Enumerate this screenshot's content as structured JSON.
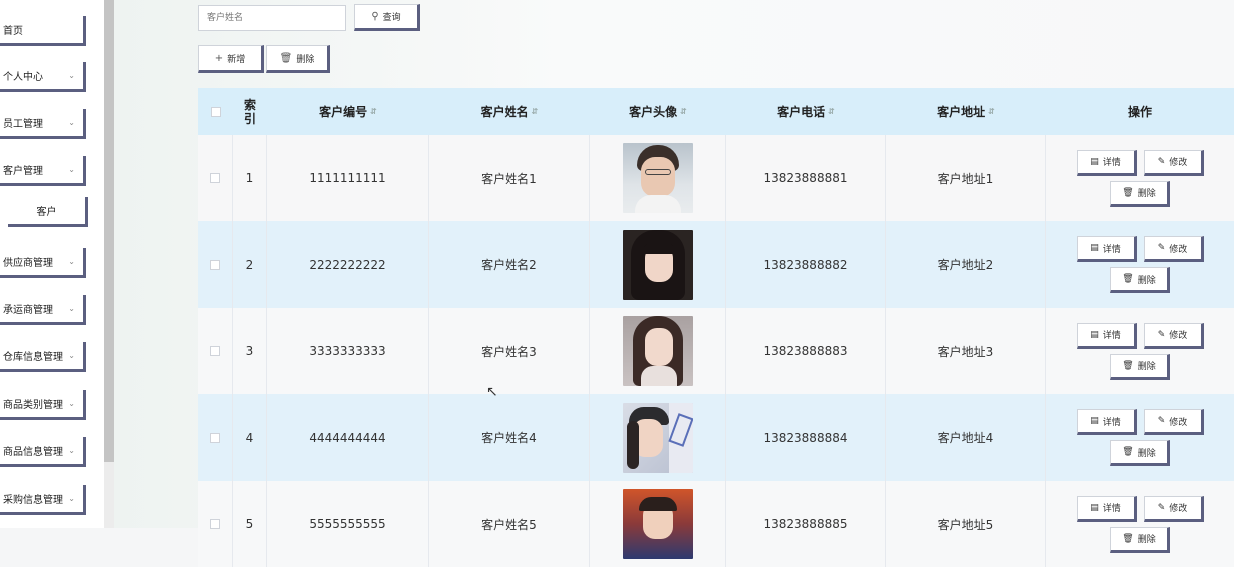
{
  "sidebar": {
    "items": [
      {
        "label": "首页",
        "chevron": false
      },
      {
        "label": "个人中心",
        "chevron": true
      },
      {
        "label": "员工管理",
        "chevron": true
      },
      {
        "label": "客户管理",
        "chevron": true
      },
      {
        "label": "客户",
        "chevron": false,
        "sub": true
      },
      {
        "label": "供应商管理",
        "chevron": true
      },
      {
        "label": "承运商管理",
        "chevron": true
      },
      {
        "label": "仓库信息管理",
        "chevron": true
      },
      {
        "label": "商品类别管理",
        "chevron": true
      },
      {
        "label": "商品信息管理",
        "chevron": true
      },
      {
        "label": "采购信息管理",
        "chevron": true
      }
    ]
  },
  "search": {
    "placeholder": "客户姓名",
    "query_label": "查询"
  },
  "toolbar": {
    "add_label": "新增",
    "delete_label": "删除"
  },
  "table": {
    "columns": [
      "索引",
      "客户编号",
      "客户姓名",
      "客户头像",
      "客户电话",
      "客户地址",
      "操作"
    ],
    "rows": [
      {
        "index": "1",
        "code": "1111111111",
        "name": "客户姓名1",
        "phone": "13823888881",
        "address": "客户地址1"
      },
      {
        "index": "2",
        "code": "2222222222",
        "name": "客户姓名2",
        "phone": "13823888882",
        "address": "客户地址2"
      },
      {
        "index": "3",
        "code": "3333333333",
        "name": "客户姓名3",
        "phone": "13823888883",
        "address": "客户地址3"
      },
      {
        "index": "4",
        "code": "4444444444",
        "name": "客户姓名4",
        "phone": "13823888884",
        "address": "客户地址4"
      },
      {
        "index": "5",
        "code": "5555555555",
        "name": "客户姓名5",
        "phone": "13823888885",
        "address": "客户地址5"
      }
    ],
    "actions": {
      "detail": "详情",
      "edit": "修改",
      "delete": "删除"
    }
  },
  "colors": {
    "header_bg": "#d8eefa",
    "stripe_bg": "#e2f1fa",
    "button_shadow": "#5b5f80"
  },
  "icons": {
    "search": "search-icon",
    "add": "plus-icon",
    "delete": "trash-icon",
    "detail": "document-icon",
    "edit": "pencil-icon",
    "chevron": "chevron-down-icon"
  }
}
